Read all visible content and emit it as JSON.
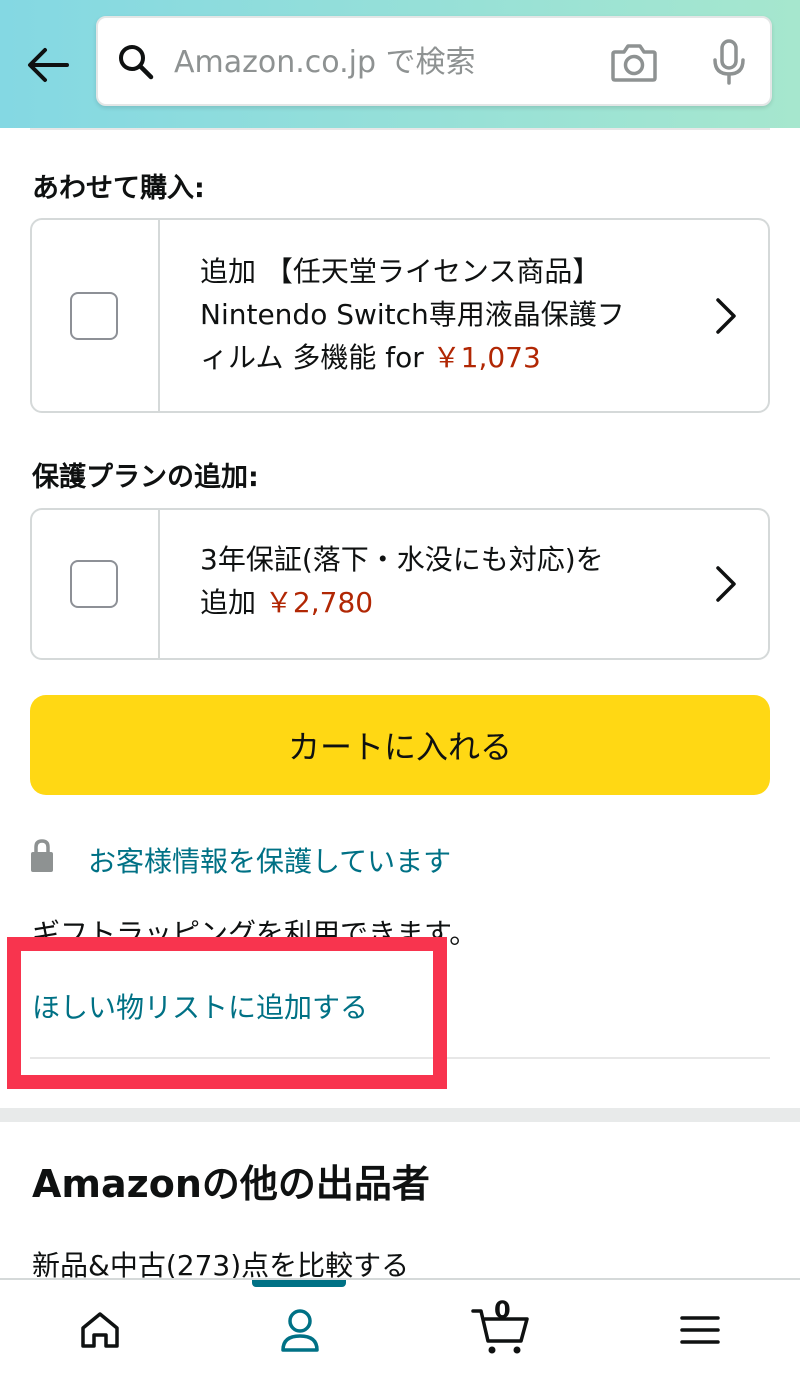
{
  "search": {
    "placeholder": "Amazon.co.jp で検索"
  },
  "frequently_bought": {
    "label": "あわせて購入:",
    "line1": "追加 【任天堂ライセンス商品】",
    "line2": "Nintendo Switch専用液晶保護フ",
    "line3": "ィルム 多機能 for",
    "price": "￥1,073"
  },
  "protection_plan": {
    "label": "保護プランの追加:",
    "line1": "3年保証(落下・水没にも対応)を",
    "line2": "追加",
    "price": "￥2,780"
  },
  "cart_button": {
    "label": "カートに入れる"
  },
  "secure": {
    "label": "お客様情報を保護しています"
  },
  "gift": {
    "text": "ギフトラッピングを利用できます。"
  },
  "wishlist": {
    "label": "ほしい物リストに追加する"
  },
  "other_sellers": {
    "title": "Amazonの他の出品者",
    "compare": "新品&中古(273)点を比較する"
  },
  "bottom_nav": {
    "cart_count": "0",
    "active_tab": "account"
  },
  "colors": {
    "header_gradient_start": "#84d8e3",
    "header_gradient_end": "#a6e7ce",
    "cart_button": "#ffd814",
    "price": "#b12704",
    "link": "#007185",
    "highlight": "#f8344e"
  }
}
